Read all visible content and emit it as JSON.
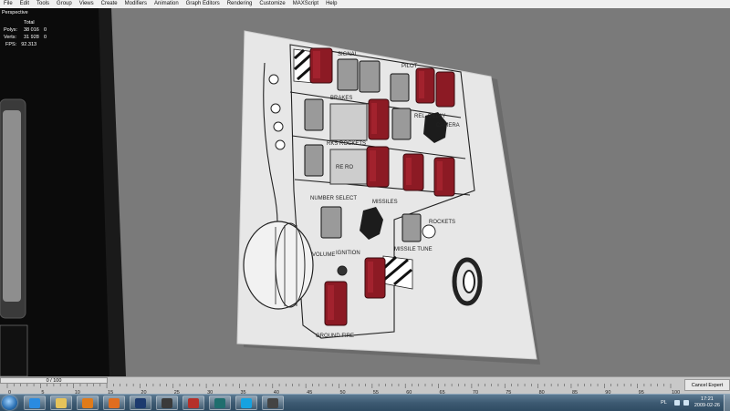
{
  "menu": [
    "File",
    "Edit",
    "Tools",
    "Group",
    "Views",
    "Create",
    "Modifiers",
    "Animation",
    "Graph Editors",
    "Rendering",
    "Customize",
    "MAXScript",
    "Help"
  ],
  "viewport": {
    "name": "Perspective",
    "stats": {
      "header": "Total",
      "polys_label": "Polys:",
      "polys_value": "38 016",
      "polys_sel": "0",
      "verts_label": "Verts:",
      "verts_value": "31 928",
      "verts_sel": "0",
      "fps_label": "FPS:",
      "fps_value": "92.313"
    }
  },
  "panel_text": {
    "t1": "SIGNAL",
    "t2": "BRAKES",
    "t3": "PILOT",
    "t4": "REL. DELAY",
    "t5": "CAMERA",
    "t6": "RKS ROCKETS",
    "t7": "MISSILES",
    "t8": "VOLUME",
    "t9": "IGNITION",
    "t10": "GROUND FIRE",
    "t11": "NUMBER SELECT",
    "t12": "MISSILE TUNE",
    "t13": "ROCKETS",
    "t14": "RE RO"
  },
  "timeline": {
    "slider_label": "0 / 100",
    "ticks": [
      "0",
      "5",
      "10",
      "15",
      "20",
      "25",
      "30",
      "35",
      "40",
      "45",
      "50",
      "55",
      "60",
      "65",
      "70",
      "75",
      "80",
      "85",
      "90",
      "95",
      "100"
    ],
    "expert_button": "Cancel Expert Mode"
  },
  "taskbar": {
    "apps": [
      {
        "name": "ie-icon",
        "color": "#2a8be0"
      },
      {
        "name": "explorer-icon",
        "color": "#e6c35a"
      },
      {
        "name": "media-player-icon",
        "color": "#e07b1a"
      },
      {
        "name": "firefox-icon",
        "color": "#e06d1f"
      },
      {
        "name": "photoshop-icon",
        "color": "#1c3a6e"
      },
      {
        "name": "movie-maker-icon",
        "color": "#3a3a3a"
      },
      {
        "name": "image-viewer-icon",
        "color": "#b5302a"
      },
      {
        "name": "3dsmax-icon",
        "color": "#1f6e6e"
      },
      {
        "name": "skype-icon",
        "color": "#16a2e0"
      },
      {
        "name": "video-icon",
        "color": "#444"
      }
    ],
    "lang": "PL",
    "time": "17:21",
    "date": "2009-02-26"
  }
}
